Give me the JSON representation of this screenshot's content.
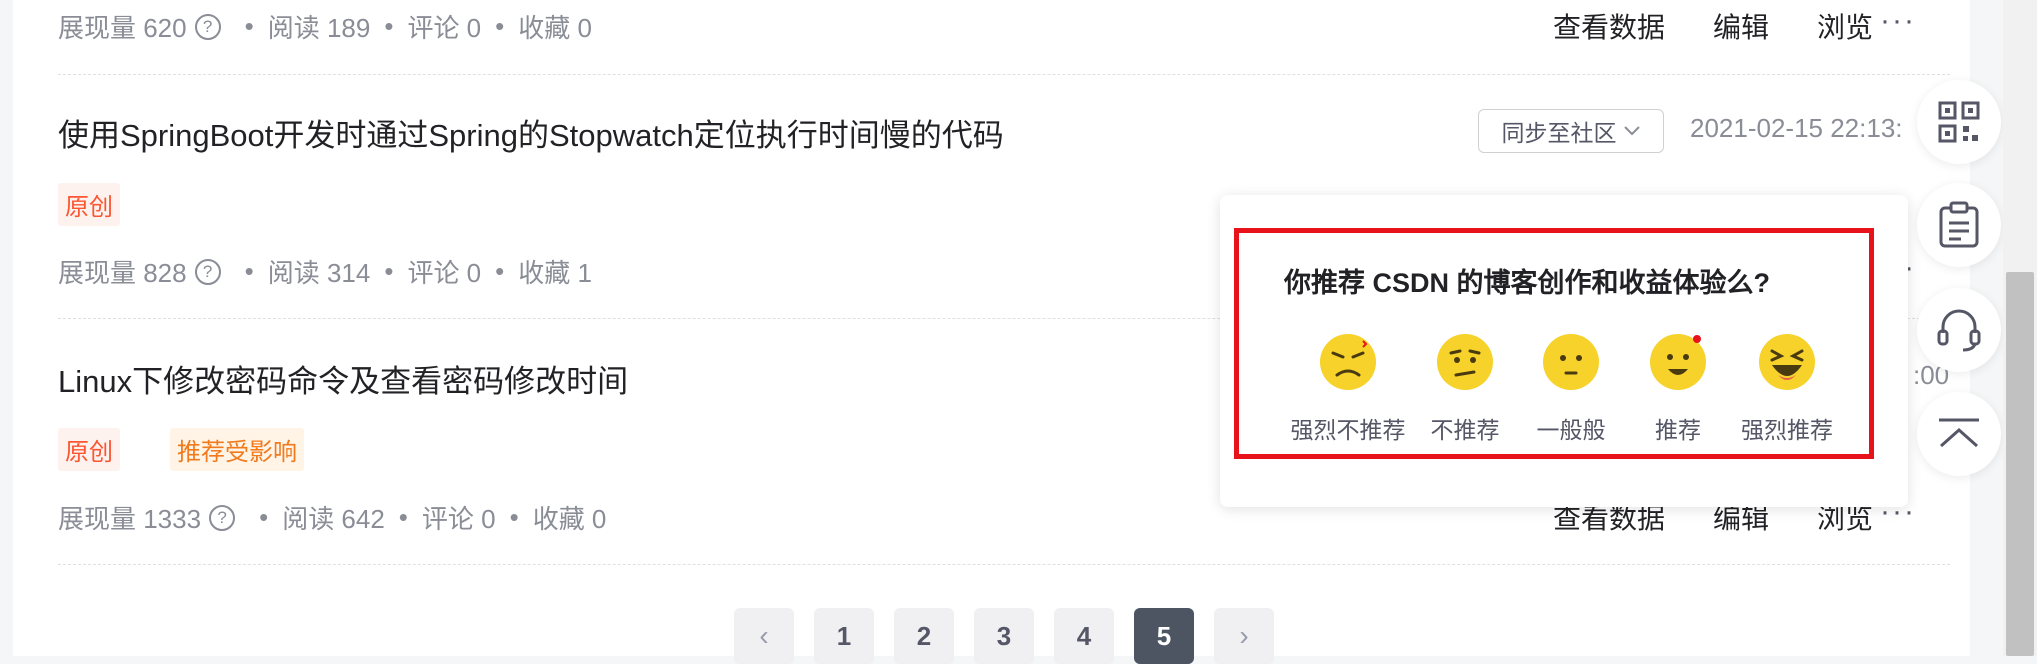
{
  "articles": [
    {
      "stats": {
        "views_label": "展现量 620",
        "help": "?",
        "reads": "阅读 189",
        "comments": "评论 0",
        "favorites": "收藏 0"
      },
      "actions": {
        "data": "查看数据",
        "edit": "编辑",
        "browse": "浏览",
        "more": "···"
      }
    },
    {
      "title": "使用SpringBoot开发时通过Spring的Stopwatch定位执行时间慢的代码",
      "tag_original": "原创",
      "sync_button": "同步至社区",
      "date": "2021-02-15 22:13:",
      "stats": {
        "views_label": "展现量 828",
        "help": "?",
        "reads": "阅读 314",
        "comments": "评论 0",
        "favorites": "收藏 1"
      },
      "more": "···"
    },
    {
      "title": "Linux下修改密码命令及查看密码修改时间",
      "tag_original": "原创",
      "tag_recommend": "推荐受影响",
      "partial_time": ":00",
      "stats": {
        "views_label": "展现量 1333",
        "help": "?",
        "reads": "阅读 642",
        "comments": "评论 0",
        "favorites": "收藏 0"
      },
      "actions": {
        "data": "查看数据",
        "edit": "编辑",
        "browse": "浏览",
        "more": "···"
      }
    }
  ],
  "stats_separator": "•",
  "pagination": {
    "prev": "‹",
    "pages": [
      "1",
      "2",
      "3",
      "4",
      "5"
    ],
    "current": "5",
    "next": "›"
  },
  "survey": {
    "question": "你推荐 CSDN 的博客创作和收益体验么?",
    "options": [
      {
        "label": "强烈不推荐",
        "icon": "very-angry-face-icon"
      },
      {
        "label": "不推荐",
        "icon": "frowning-face-icon"
      },
      {
        "label": "一般般",
        "icon": "neutral-face-icon"
      },
      {
        "label": "推荐",
        "icon": "smiling-face-icon"
      },
      {
        "label": "强烈推荐",
        "icon": "laughing-face-icon"
      }
    ],
    "highlight_color": "#e8121b"
  },
  "sidebar_icons": [
    "qr-code-icon",
    "clipboard-icon",
    "headset-icon",
    "back-to-top-icon"
  ],
  "colors": {
    "tag_red": "#fc5531",
    "tag_orange": "#f07a1c",
    "emoji_yellow": "#f6d22b",
    "active_page": "#4d5563"
  }
}
